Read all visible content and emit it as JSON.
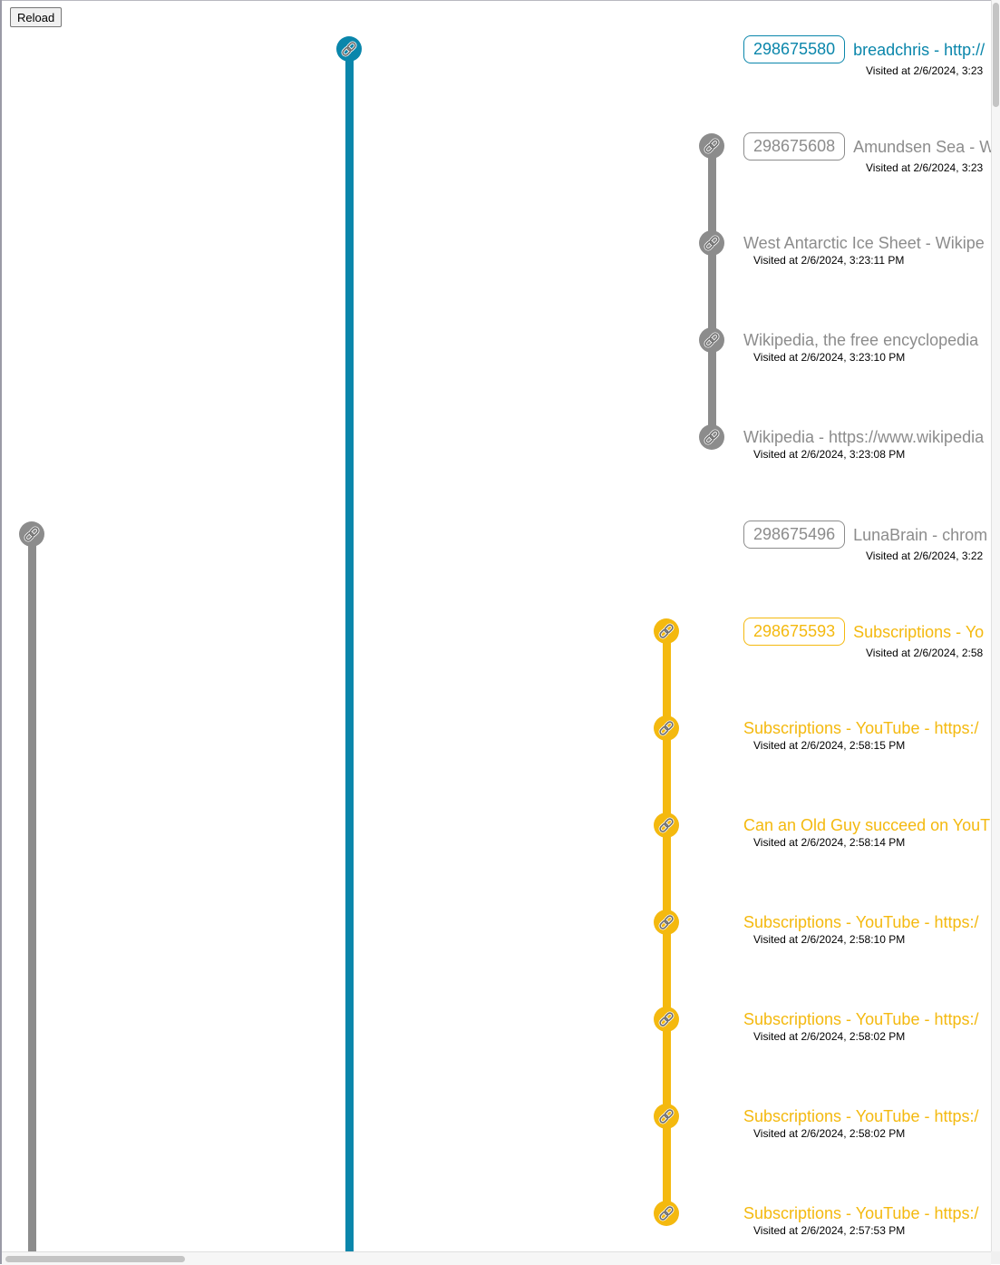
{
  "reload_label": "Reload",
  "colors": {
    "blue": "#0a86ab",
    "gray": "#8c8c8c",
    "yellow": "#f4b90f"
  },
  "icons": {
    "node": "link-icon"
  },
  "timeline": [
    {
      "badge": "298675580",
      "title": "breadchris - http://",
      "visited": "Visited at 2/6/2024, 3:23",
      "color": "blue"
    },
    {
      "badge": "298675608",
      "title": "Amundsen Sea - W",
      "visited": "Visited at 2/6/2024, 3:23",
      "color": "gray"
    },
    {
      "badge": "",
      "title": "West Antarctic Ice Sheet - Wikipe",
      "visited": "Visited at 2/6/2024, 3:23:11 PM",
      "color": "gray"
    },
    {
      "badge": "",
      "title": "Wikipedia, the free encyclopedia",
      "visited": "Visited at 2/6/2024, 3:23:10 PM",
      "color": "gray"
    },
    {
      "badge": "",
      "title": "Wikipedia - https://www.wikipedia",
      "visited": "Visited at 2/6/2024, 3:23:08 PM",
      "color": "gray"
    },
    {
      "badge": "298675496",
      "title": "LunaBrain - chrom",
      "visited": "Visited at 2/6/2024, 3:22",
      "color": "gray"
    },
    {
      "badge": "298675593",
      "title": "Subscriptions - Yo",
      "visited": "Visited at 2/6/2024, 2:58",
      "color": "yellow"
    },
    {
      "badge": "",
      "title": "Subscriptions - YouTube - https:/",
      "visited": "Visited at 2/6/2024, 2:58:15 PM",
      "color": "yellow"
    },
    {
      "badge": "",
      "title": "Can an Old Guy succeed on YouT",
      "visited": "Visited at 2/6/2024, 2:58:14 PM",
      "color": "yellow"
    },
    {
      "badge": "",
      "title": "Subscriptions - YouTube - https:/",
      "visited": "Visited at 2/6/2024, 2:58:10 PM",
      "color": "yellow"
    },
    {
      "badge": "",
      "title": "Subscriptions - YouTube - https:/",
      "visited": "Visited at 2/6/2024, 2:58:02 PM",
      "color": "yellow"
    },
    {
      "badge": "",
      "title": "Subscriptions - YouTube - https:/",
      "visited": "Visited at 2/6/2024, 2:58:02 PM",
      "color": "yellow"
    },
    {
      "badge": "",
      "title": "Subscriptions - YouTube - https:/",
      "visited": "Visited at 2/6/2024, 2:57:53 PM",
      "color": "yellow"
    }
  ]
}
